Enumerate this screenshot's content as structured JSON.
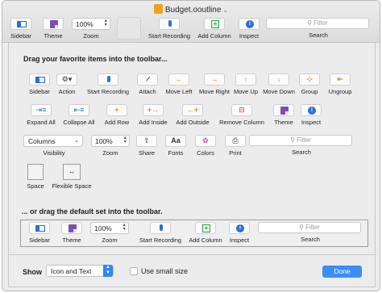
{
  "window": {
    "title": "Budget.ooutline"
  },
  "toolbar": {
    "sidebar": "Sidebar",
    "theme": "Theme",
    "zoom_value": "100%",
    "zoom": "Zoom",
    "start_recording": "Start Recording",
    "add_column": "Add Column",
    "inspect": "Inspect",
    "search_placeholder": "Filter",
    "search": "Search"
  },
  "sheet": {
    "heading": "Drag your favorite items into the toolbar...",
    "row1": [
      {
        "label": "Sidebar",
        "icon": "sidebar-icon"
      },
      {
        "label": "Action",
        "icon": "gear-icon"
      },
      {
        "label": "Start Recording",
        "icon": "microphone-icon"
      },
      {
        "label": "Attach",
        "icon": "paperclip-icon"
      },
      {
        "label": "Move Left",
        "icon": "arrow-left-icon"
      },
      {
        "label": "Move Right",
        "icon": "arrow-right-icon"
      },
      {
        "label": "Move Up",
        "icon": "arrow-up-icon"
      },
      {
        "label": "Move Down",
        "icon": "arrow-down-icon"
      },
      {
        "label": "Group",
        "icon": "group-icon"
      },
      {
        "label": "Ungroup",
        "icon": "ungroup-icon"
      }
    ],
    "row2": [
      {
        "label": "Expand All",
        "icon": "expand-all-icon"
      },
      {
        "label": "Collapse All",
        "icon": "collapse-all-icon"
      },
      {
        "label": "Add Row",
        "icon": "add-row-icon"
      },
      {
        "label": "Add Inside",
        "icon": "add-inside-icon"
      },
      {
        "label": "Add Outside",
        "icon": "add-outside-icon"
      },
      {
        "label": "Remove Column",
        "icon": "remove-column-icon"
      },
      {
        "label": "Theme",
        "icon": "theme-icon"
      },
      {
        "label": "Inspect",
        "icon": "info-icon"
      }
    ],
    "row3": {
      "visibility_value": "Columns",
      "visibility": "Visibility",
      "zoom_value": "100%",
      "zoom": "Zoom",
      "share": "Share",
      "fonts_glyph": "Aa",
      "fonts": "Fonts",
      "colors": "Colors",
      "print": "Print",
      "search_placeholder": "Filter",
      "search": "Search"
    },
    "row4": {
      "space": "Space",
      "flexible_space": "Flexible Space"
    },
    "default_heading": "... or drag the default set into the toolbar.",
    "default_set": {
      "sidebar": "Sidebar",
      "theme": "Theme",
      "zoom_value": "100%",
      "zoom": "Zoom",
      "start_recording": "Start Recording",
      "add_column": "Add Column",
      "inspect": "Inspect",
      "search_placeholder": "Filter",
      "search": "Search"
    }
  },
  "footer": {
    "show_label": "Show",
    "show_value": "Icon and Text",
    "small_size": "Use small size",
    "done": "Done"
  },
  "colors": {
    "accent": "#3b8ff3",
    "orange": "#f07d1e",
    "green": "#29a34a",
    "purple": "#7b4fb0"
  }
}
